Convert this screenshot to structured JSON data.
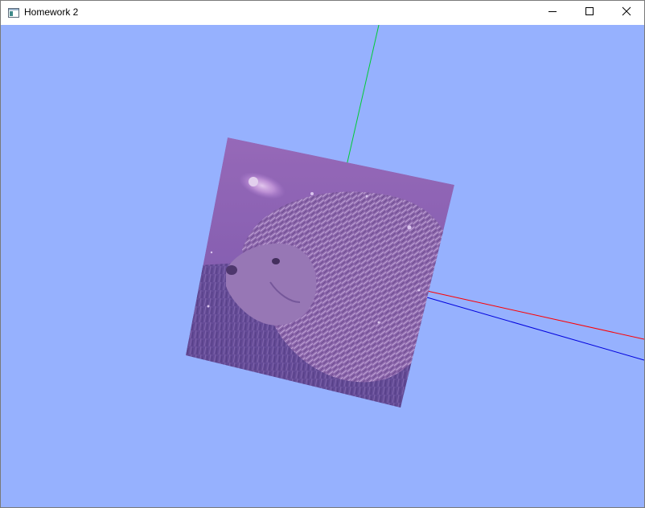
{
  "window": {
    "title": "Homework 2",
    "icon": "app-window-icon",
    "controls": [
      {
        "name": "minimize",
        "icon": "minimize-icon"
      },
      {
        "name": "maximize",
        "icon": "maximize-icon"
      },
      {
        "name": "close",
        "icon": "close-icon"
      }
    ]
  },
  "scene": {
    "background_color": "#96b1fe",
    "axes": [
      {
        "name": "x-axis",
        "color": "#ff0000"
      },
      {
        "name": "y-axis",
        "color": "#00cc33"
      },
      {
        "name": "z-axis",
        "color": "#0000dd"
      }
    ],
    "textured_quad": {
      "subject": "hedgehog",
      "tint_color": "#8a5fb8"
    }
  }
}
